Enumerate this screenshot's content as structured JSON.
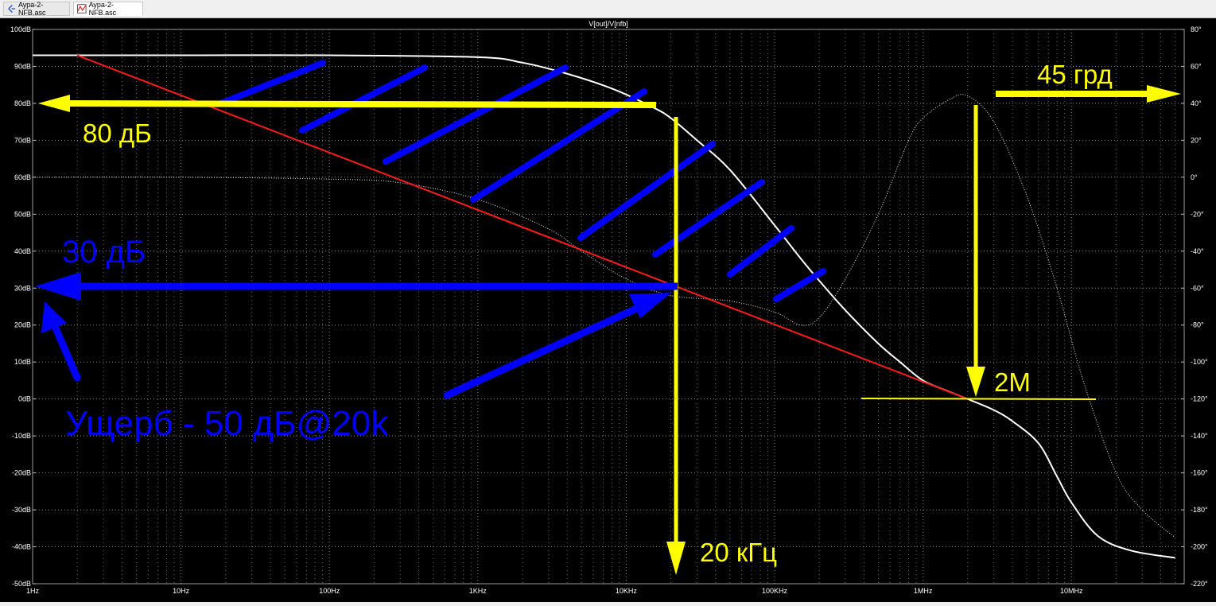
{
  "tabs": [
    {
      "label": "Aypa-2-NFB.asc",
      "icon": "schematic-icon"
    },
    {
      "label": "Aypa-2-NFB.asc",
      "icon": "waveform-icon"
    }
  ],
  "colors": {
    "background": "#000000",
    "grid": "#8a8a8a",
    "magnitude": "#ffffff",
    "phase": "#e8e8e8",
    "asymptote": "#ff1a1a",
    "yellow": "#ffff00",
    "blue": "#0000ff"
  },
  "annotations": {
    "gain_80": "80 дБ",
    "phase_45": "45 грд",
    "gain_30": "30 дБ",
    "freq_20k": "20 кГц",
    "freq_2M": "2M",
    "loss": "Ущерб - 50 дБ@20k"
  },
  "chart_data": {
    "type": "line",
    "title": "V[out]/V[nfb]",
    "x_scale": "log",
    "xlim": [
      1,
      50000000
    ],
    "x_ticks": [
      {
        "value": 1,
        "label": "1Hz"
      },
      {
        "value": 10,
        "label": "10Hz"
      },
      {
        "value": 100,
        "label": "100Hz"
      },
      {
        "value": 1000,
        "label": "1KHz"
      },
      {
        "value": 10000,
        "label": "10KHz"
      },
      {
        "value": 100000,
        "label": "100KHz"
      },
      {
        "value": 1000000,
        "label": "1MHz"
      },
      {
        "value": 10000000,
        "label": "10MHz"
      }
    ],
    "ylim_left": [
      -50,
      100
    ],
    "y_ticks_left": [
      {
        "value": 100,
        "label": "100dB"
      },
      {
        "value": 90,
        "label": "90dB"
      },
      {
        "value": 80,
        "label": "80dB"
      },
      {
        "value": 70,
        "label": "70dB"
      },
      {
        "value": 60,
        "label": "60dB"
      },
      {
        "value": 50,
        "label": "50dB"
      },
      {
        "value": 40,
        "label": "40dB"
      },
      {
        "value": 30,
        "label": "30dB"
      },
      {
        "value": 20,
        "label": "20dB"
      },
      {
        "value": 10,
        "label": "10dB"
      },
      {
        "value": 0,
        "label": "0dB"
      },
      {
        "value": -10,
        "label": "-10dB"
      },
      {
        "value": -20,
        "label": "-20dB"
      },
      {
        "value": -30,
        "label": "-30dB"
      },
      {
        "value": -40,
        "label": "-40dB"
      },
      {
        "value": -50,
        "label": "-50dB"
      }
    ],
    "ylim_right": [
      -220,
      80
    ],
    "y_ticks_right": [
      {
        "value": 80,
        "label": "80°"
      },
      {
        "value": 60,
        "label": "60°"
      },
      {
        "value": 40,
        "label": "40°"
      },
      {
        "value": 20,
        "label": "20°"
      },
      {
        "value": 0,
        "label": "0°"
      },
      {
        "value": -20,
        "label": "-20°"
      },
      {
        "value": -40,
        "label": "-40°"
      },
      {
        "value": -60,
        "label": "-60°"
      },
      {
        "value": -80,
        "label": "-80°"
      },
      {
        "value": -100,
        "label": "-100°"
      },
      {
        "value": -120,
        "label": "-120°"
      },
      {
        "value": -140,
        "label": "-140°"
      },
      {
        "value": -160,
        "label": "-160°"
      },
      {
        "value": -180,
        "label": "-180°"
      },
      {
        "value": -200,
        "label": "-200°"
      },
      {
        "value": -220,
        "label": "-220°"
      }
    ],
    "grid": true,
    "series": [
      {
        "kind": "magnitude",
        "axis": "left",
        "style": "solid",
        "x": [
          1,
          10,
          100,
          1000,
          2000,
          4000,
          8000,
          15000,
          20000,
          30000,
          50000,
          100000,
          150000,
          200000,
          300000,
          500000,
          700000,
          1000000,
          1500000,
          2000000,
          3000000,
          4000000,
          6000000,
          8000000,
          10000000,
          15000000,
          25000000,
          50000000
        ],
        "y": [
          93,
          93,
          93,
          92.5,
          91,
          88,
          84,
          79,
          76,
          70,
          62,
          47,
          38,
          32,
          24,
          15,
          10,
          5,
          2,
          0,
          -3,
          -6,
          -12,
          -21,
          -28,
          -37,
          -41,
          -43
        ]
      },
      {
        "kind": "phase",
        "axis": "right",
        "style": "dotted",
        "x": [
          1,
          10,
          100,
          300,
          1000,
          3000,
          5000,
          10000,
          20000,
          50000,
          100000,
          150000,
          200000,
          300000,
          500000,
          800000,
          1000000,
          1500000,
          2000000,
          3000000,
          5000000,
          8000000,
          12000000,
          20000000,
          30000000,
          50000000
        ],
        "y": [
          0,
          0,
          -1,
          -3,
          -12,
          -28,
          -40,
          -55,
          -64,
          -67,
          -73,
          -80,
          -76,
          -55,
          -20,
          20,
          32,
          42,
          44,
          30,
          -10,
          -60,
          -110,
          -160,
          -180,
          -195
        ]
      },
      {
        "kind": "asymptote",
        "axis": "left",
        "style": "solid",
        "x": [
          2,
          2000000
        ],
        "y": [
          93,
          0
        ]
      }
    ]
  }
}
